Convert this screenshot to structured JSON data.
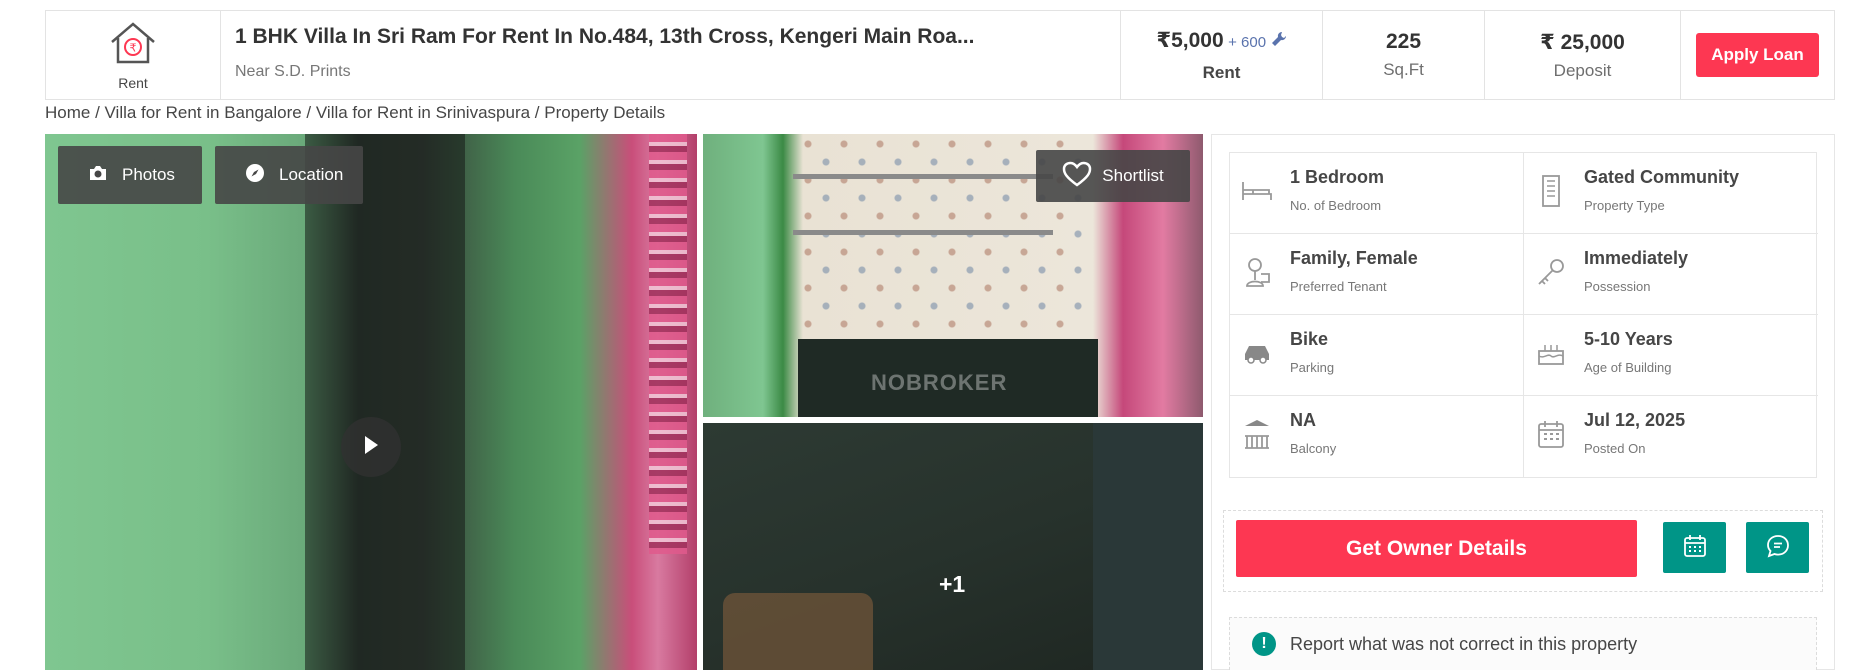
{
  "header": {
    "category_label": "Rent",
    "title": "1 BHK Villa In Sri Ram For Rent In No.484, 13th Cross, Kengeri Main Roa...",
    "subtitle": "Near S.D. Prints",
    "rent": {
      "value": "₹5,000",
      "extra": "+ 600",
      "label": "Rent"
    },
    "area": {
      "value": "225",
      "label": "Sq.Ft"
    },
    "deposit": {
      "value": "₹ 25,000",
      "label": "Deposit"
    },
    "apply_label": "Apply Loan"
  },
  "breadcrumb": "Home / Villa for Rent in Bangalore / Villa for Rent in Srinivaspura / Property Details",
  "gallery": {
    "photos_label": "Photos",
    "location_label": "Location",
    "shortlist_label": "Shortlist",
    "watermark": "NOBROKER",
    "more_count": "+1"
  },
  "details": [
    {
      "icon": "bed-icon",
      "value": "1 Bedroom",
      "label": "No. of Bedroom"
    },
    {
      "icon": "building-icon",
      "value": "Gated Community",
      "label": "Property Type"
    },
    {
      "icon": "tenant-icon",
      "value": "Family, Female",
      "label": "Preferred Tenant"
    },
    {
      "icon": "key-icon",
      "value": "Immediately",
      "label": "Possession"
    },
    {
      "icon": "car-icon",
      "value": "Bike",
      "label": "Parking"
    },
    {
      "icon": "cake-icon",
      "value": "5-10 Years",
      "label": "Age of Building"
    },
    {
      "icon": "balcony-icon",
      "value": "NA",
      "label": "Balcony"
    },
    {
      "icon": "calendar-icon",
      "value": "Jul 12, 2025",
      "label": "Posted On"
    }
  ],
  "actions": {
    "owner_label": "Get Owner Details",
    "schedule_icon": "calendar-icon",
    "chat_icon": "chat-icon"
  },
  "report": {
    "icon": "exclamation-icon",
    "text": "Report what was not correct in this property"
  },
  "colors": {
    "accent_red": "#fd3752",
    "accent_teal": "#009587",
    "link_blue": "#5a73ad"
  }
}
